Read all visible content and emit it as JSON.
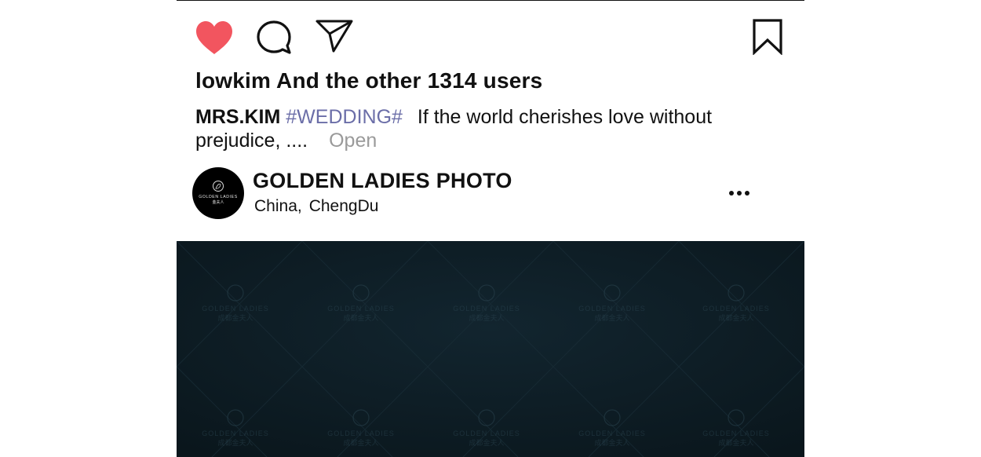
{
  "actions": {
    "like_icon": "heart-filled-icon",
    "comment_icon": "speech-bubble-icon",
    "share_icon": "paper-plane-icon",
    "bookmark_icon": "bookmark-icon",
    "like_color": "#f2555f"
  },
  "likes": {
    "text": "lowkim And the other 1314 users"
  },
  "caption": {
    "author": "MRS.KIM",
    "hashtag": "#WEDDING#",
    "text": "If the world cherishes love without prejudice, ....",
    "open_label": "Open",
    "hashtag_color": "#6b6ea8"
  },
  "account": {
    "avatar_logo_text": "GOLDEN LADIES",
    "avatar_logo_subtext": "金夫人",
    "name": "GOLDEN LADIES PHOTO",
    "location_country": "China,",
    "location_city": "ChengDu",
    "more_icon": "more-dots-icon"
  },
  "photo": {
    "background_color": "#0d1c24",
    "watermark_text": "GOLDEN LADIES",
    "watermark_subtext": "成都金夫人"
  }
}
